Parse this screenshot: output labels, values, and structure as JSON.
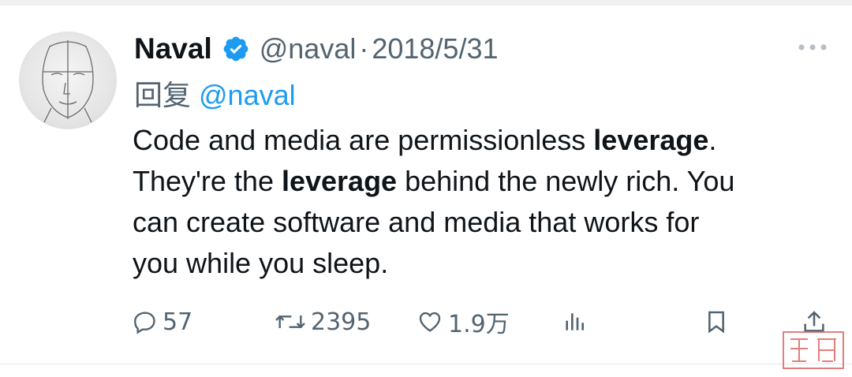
{
  "tweet": {
    "author": {
      "name": "Naval",
      "handle": "@naval",
      "verified": true
    },
    "separator": "·",
    "date": "2018/5/31",
    "reply_prefix": "回复",
    "reply_to": "@naval",
    "text_lines": [
      [
        "Code and media are permissionless ",
        "leverage",
        "."
      ],
      [
        "They're the ",
        "leverage",
        " behind the newly rich. You"
      ],
      [
        "can create software and media that works for"
      ],
      [
        "you while you sleep."
      ]
    ],
    "stats": {
      "replies": "57",
      "retweets": "2395",
      "likes": "1.9万"
    }
  },
  "icons": {
    "verified": "verified-badge-icon",
    "more": "more-icon",
    "reply": "reply-icon",
    "retweet": "retweet-icon",
    "like": "heart-icon",
    "views": "views-icon",
    "bookmark": "bookmark-icon",
    "share": "share-icon"
  },
  "colors": {
    "accent": "#1d9bf0",
    "text_primary": "#0f1419",
    "text_secondary": "#536471",
    "stamp": "#d9534f"
  }
}
